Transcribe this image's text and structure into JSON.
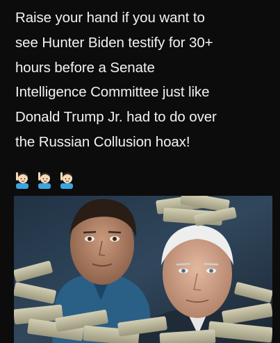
{
  "caption": {
    "lines": [
      "Raise your hand if you want to",
      "see Hunter Biden testify for 30+",
      "hours before a Senate",
      "Intelligence Committee just like",
      "Donald Trump Jr. had to do over",
      "the Russian Collusion hoax!"
    ]
  },
  "emojis": [
    "raising-hand-emoji",
    "raising-hand-emoji",
    "raising-hand-emoji"
  ],
  "photo": {
    "subjects": [
      "young-man-portrait",
      "older-man-portrait"
    ],
    "props": "stacks-of-cash"
  },
  "colors": {
    "background": "#0b0b0b",
    "text": "#f2f2f2",
    "emoji_shirt": "#3aa6e0",
    "emoji_hair": "#2b2b2b",
    "emoji_skin": "#f7d9b8",
    "cash": "#b9b59a"
  }
}
